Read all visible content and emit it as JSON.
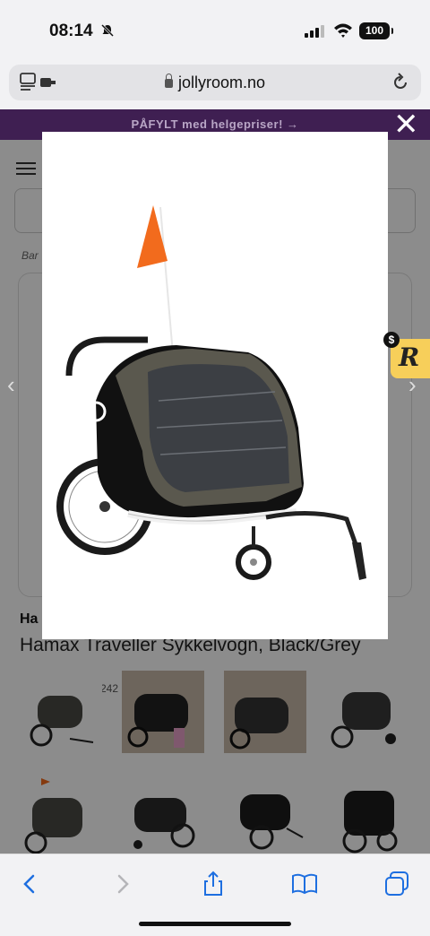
{
  "status_bar": {
    "time": "08:14",
    "battery": "100"
  },
  "browser": {
    "url": "jollyroom.no"
  },
  "page": {
    "promo": "PÅFYLT med helgepriser! →",
    "breadcrumb": "Bar",
    "brand": "Ha",
    "product_title": "Hamax Traveller Sykkelvogn, Black/Grey",
    "sku_partial": "242"
  },
  "badge": {
    "letter": "R",
    "dollar": "$"
  },
  "colors": {
    "promo_bg": "#3f1f52",
    "flag": "#f26b1d",
    "badge": "#f7cf5a"
  },
  "icons": [
    "tabs-icon",
    "lock-icon",
    "reload-icon",
    "close-icon",
    "back-icon",
    "forward-icon",
    "share-icon",
    "bookmarks-icon",
    "tabs-overview-icon"
  ]
}
